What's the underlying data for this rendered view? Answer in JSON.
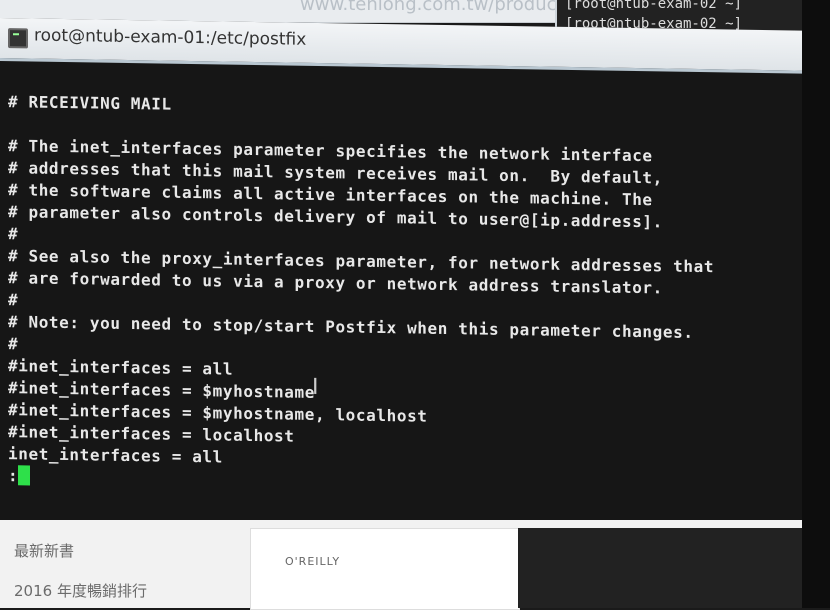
{
  "background_browser": {
    "url_fragment": "www.tenlong.com.tw/produc",
    "sidebar_link_1": "最新新書",
    "sidebar_link_2": "2016 年度暢銷排行",
    "book_publisher": "O'REILLY"
  },
  "background_terminal": {
    "line1": "[root@ntub-exam-02 ~]",
    "line2": "[root@ntub-exam-02 ~]"
  },
  "terminal": {
    "title": "root@ntub-exam-01:/etc/postfix",
    "lines": [
      "# RECEIVING MAIL",
      "",
      "# The inet_interfaces parameter specifies the network interface",
      "# addresses that this mail system receives mail on.  By default,",
      "# the software claims all active interfaces on the machine. The",
      "# parameter also controls delivery of mail to user@[ip.address].",
      "#",
      "# See also the proxy_interfaces parameter, for network addresses that",
      "# are forwarded to us via a proxy or network address translator.",
      "#",
      "# Note: you need to stop/start Postfix when this parameter changes.",
      "#",
      "#inet_interfaces = all",
      "#inet_interfaces = $myhostname",
      "#inet_interfaces = $myhostname, localhost",
      "#inet_interfaces = localhost",
      "inet_interfaces = all"
    ],
    "prompt": ":",
    "cursor_color": "#2ee04a"
  }
}
